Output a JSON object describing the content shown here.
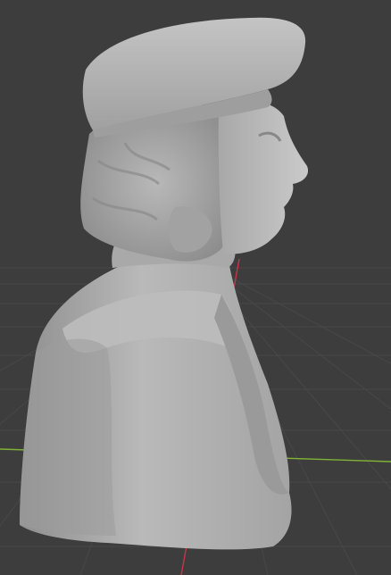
{
  "viewport": {
    "background": "#3d3d3d",
    "grid_color": "#4a4a4a",
    "axis_x_color": "#8fc23f",
    "axis_y_color": "#d03a4f"
  },
  "model": {
    "description": "sculpted-bust-mesh",
    "material_color": "#b3b3b3"
  }
}
